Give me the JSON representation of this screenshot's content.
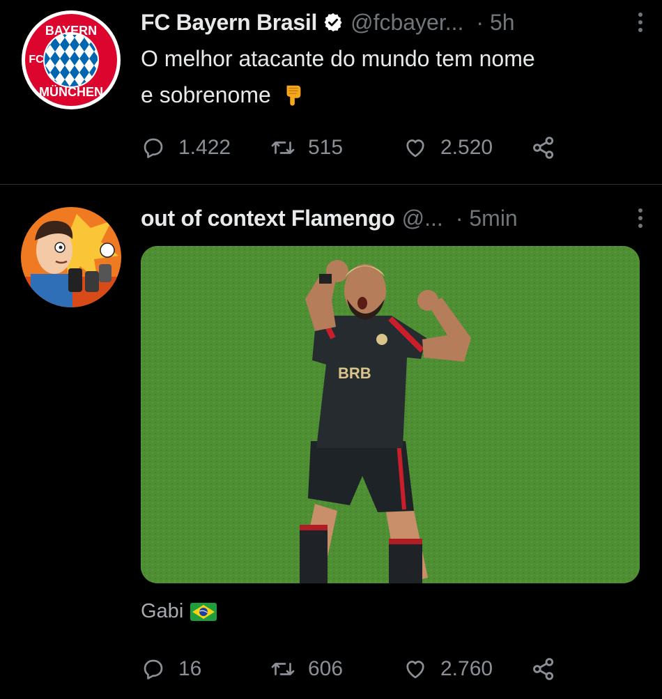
{
  "colors": {
    "background": "#000000",
    "text": "#e7e9ea",
    "muted": "#71767b",
    "divider": "#2f3336",
    "verified": "#ffffff"
  },
  "tweets": [
    {
      "avatar_icon": "fc-bayern-logo",
      "name": "FC Bayern Brasil",
      "verified": true,
      "handle": "@fcbayer...",
      "time": "· 5h",
      "text_line1": "O melhor atacante do mundo tem nome",
      "text_line2": "e sobrenome",
      "text_emoji": "pointing-down-hand-emoji",
      "replies": "1.422",
      "retweets": "515",
      "likes": "2.520"
    },
    {
      "avatar_icon": "cartoon-reporter-avatar",
      "name": "out of context Flamengo",
      "handle": "@...",
      "time": "· 5min",
      "media": "photo-player-celebrating-flexing",
      "caption": "Gabi",
      "caption_emoji": "brazil-flag-emoji",
      "replies": "16",
      "retweets": "606",
      "likes": "2.760"
    }
  ]
}
